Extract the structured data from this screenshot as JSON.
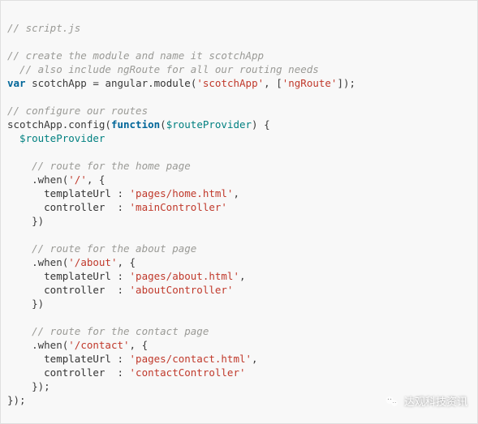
{
  "c1": "// script.js",
  "c2": "// create the module and name it scotchApp",
  "c3": "  // also include ngRoute for all our routing needs",
  "kwVar": "var",
  "varName": " scotchApp ",
  "eq": "= ",
  "ang": "angular",
  "dot1": ".",
  "module": "module",
  "op1": "(",
  "s1": "'scotchApp'",
  "comma1": ", [",
  "s2": "'ngRoute'",
  "close1": "]);",
  "c4": "// configure our routes",
  "cfgL": "scotchApp.config(",
  "kwFn": "function",
  "cfgM": "(",
  "rp": "$routeProvider",
  "cfgR": ") {",
  "rp2": "  $routeProvider",
  "c5": "    // route for the home page",
  "w1a": "    .when(",
  "w1s": "'/'",
  "w1b": ", {",
  "t1a": "      templateUrl : ",
  "t1s": "'pages/home.html'",
  "t1c": ",",
  "ct1a": "      controller  : ",
  "ct1s": "'mainController'",
  "cb1": "    })",
  "c6": "    // route for the about page",
  "w2a": "    .when(",
  "w2s": "'/about'",
  "w2b": ", {",
  "t2a": "      templateUrl : ",
  "t2s": "'pages/about.html'",
  "t2c": ",",
  "ct2a": "      controller  : ",
  "ct2s": "'aboutController'",
  "cb2": "    })",
  "c7": "    // route for the contact page",
  "w3a": "    .when(",
  "w3s": "'/contact'",
  "w3b": ", {",
  "t3a": "      templateUrl : ",
  "t3s": "'pages/contact.html'",
  "t3c": ",",
  "ct3a": "      controller  : ",
  "ct3s": "'contactController'",
  "cb3": "    });",
  "end": "});",
  "wm": "达观科技资讯"
}
